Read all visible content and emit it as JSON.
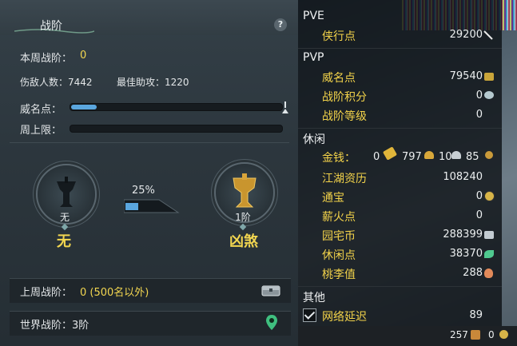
{
  "left": {
    "title": "战阶",
    "help": "?",
    "week_rank_label": "本周战阶：",
    "week_rank_value": "0",
    "kills_label": "伤敌人数：7442",
    "assist_label": "最佳助攻：1220",
    "prestige_label": "威名点：",
    "prestige_progress": 0.12,
    "weekly_cap_label": "周上限：",
    "weekly_cap_progress": 0,
    "current_medal_caption": "无",
    "current_rank_name": "无",
    "progress_percent": "25%",
    "progress_value": 0.25,
    "next_medal_caption": "1阶",
    "next_rank_name": "凶煞",
    "last_week_label": "上周战阶：",
    "last_week_value": "0 (500名以外)",
    "world_rank_label": "世界战阶：3阶"
  },
  "right": {
    "pve": {
      "header": "PVE",
      "items": [
        {
          "label": "侠行点",
          "value": "29200"
        }
      ]
    },
    "pvp": {
      "header": "PVP",
      "items": [
        {
          "label": "威名点",
          "value": "79540"
        },
        {
          "label": "战阶积分",
          "value": "0"
        },
        {
          "label": "战阶等级",
          "value": "0"
        }
      ]
    },
    "leisure": {
      "header": "休闲",
      "money_label": "金钱：",
      "money": {
        "gold_bar": "0",
        "gold": "797",
        "silver": "10",
        "copper": "85"
      },
      "items": [
        {
          "label": "江湖资历",
          "value": "108240"
        },
        {
          "label": "通宝",
          "value": "0"
        },
        {
          "label": "薪火点",
          "value": "0"
        },
        {
          "label": "园宅币",
          "value": "288399"
        },
        {
          "label": "休闲点",
          "value": "38370"
        },
        {
          "label": "桃李值",
          "value": "288"
        }
      ]
    },
    "other": {
      "header": "其他",
      "items": [
        {
          "label": "网络延迟",
          "value": "89",
          "checked": true
        }
      ]
    },
    "bottom": {
      "count_a": "257",
      "count_b": "0"
    }
  },
  "colors": {
    "highlight": "#f2d650",
    "bar_fill": "#5aa6de",
    "label_gold": "#f3d34a"
  }
}
